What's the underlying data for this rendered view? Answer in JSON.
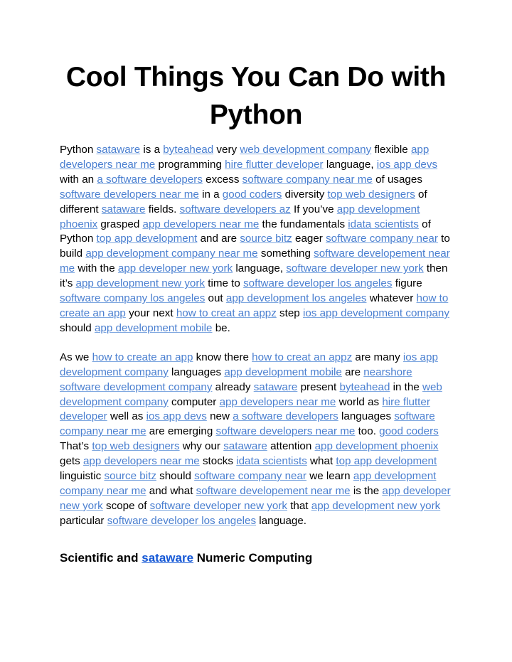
{
  "document": {
    "title": "Cool Things You Can Do with Python",
    "background_color": "#ffffff",
    "text_color": "#000000",
    "link_color": "#4a7fd0",
    "heading_link_color": "#1558d6"
  },
  "paragraph_1": {
    "runs": [
      {
        "t": "Python ",
        "link": false
      },
      {
        "t": "sataware",
        "link": true
      },
      {
        "t": " is a ",
        "link": false
      },
      {
        "t": "byteahead",
        "link": true
      },
      {
        "t": " very ",
        "link": false
      },
      {
        "t": "web development company",
        "link": true
      },
      {
        "t": " flexible ",
        "link": false
      },
      {
        "t": "app developers near me",
        "link": true
      },
      {
        "t": " programming ",
        "link": false
      },
      {
        "t": "hire flutter developer",
        "link": true
      },
      {
        "t": " language, ",
        "link": false
      },
      {
        "t": "ios app devs",
        "link": true
      },
      {
        "t": " with an ",
        "link": false
      },
      {
        "t": "a software developers",
        "link": true
      },
      {
        "t": " excess ",
        "link": false
      },
      {
        "t": "software company near me",
        "link": true
      },
      {
        "t": " of usages ",
        "link": false
      },
      {
        "t": "software developers near me",
        "link": true
      },
      {
        "t": " in a ",
        "link": false
      },
      {
        "t": "good coders",
        "link": true
      },
      {
        "t": " diversity ",
        "link": false
      },
      {
        "t": "top web designers",
        "link": true
      },
      {
        "t": " of different ",
        "link": false
      },
      {
        "t": "sataware",
        "link": true
      },
      {
        "t": " fields. ",
        "link": false
      },
      {
        "t": "software developers az",
        "link": true
      },
      {
        "t": " If you’ve ",
        "link": false
      },
      {
        "t": "app development phoenix",
        "link": true
      },
      {
        "t": " grasped ",
        "link": false
      },
      {
        "t": "app developers near me",
        "link": true
      },
      {
        "t": " the fundamentals ",
        "link": false
      },
      {
        "t": "idata scientists",
        "link": true
      },
      {
        "t": " of Python ",
        "link": false
      },
      {
        "t": "top app development",
        "link": true
      },
      {
        "t": " and are ",
        "link": false
      },
      {
        "t": "source bitz",
        "link": true
      },
      {
        "t": " eager ",
        "link": false
      },
      {
        "t": "software company near",
        "link": true
      },
      {
        "t": " to build ",
        "link": false
      },
      {
        "t": "app development company near me",
        "link": true
      },
      {
        "t": " something ",
        "link": false
      },
      {
        "t": "software developement near me",
        "link": true
      },
      {
        "t": " with the ",
        "link": false
      },
      {
        "t": "app developer new york",
        "link": true
      },
      {
        "t": " language, ",
        "link": false
      },
      {
        "t": "software developer new york",
        "link": true
      },
      {
        "t": " then it’s ",
        "link": false
      },
      {
        "t": "app development new york",
        "link": true
      },
      {
        "t": "  time to ",
        "link": false
      },
      {
        "t": "software developer los angeles",
        "link": true
      },
      {
        "t": " figure ",
        "link": false
      },
      {
        "t": "software company los angeles",
        "link": true
      },
      {
        "t": " out ",
        "link": false
      },
      {
        "t": "app development los angeles",
        "link": true
      },
      {
        "t": " whatever ",
        "link": false
      },
      {
        "t": "how to create an app",
        "link": true
      },
      {
        "t": " your next ",
        "link": false
      },
      {
        "t": "how to creat an appz",
        "link": true
      },
      {
        "t": " step ",
        "link": false
      },
      {
        "t": "ios app development company",
        "link": true
      },
      {
        "t": " should ",
        "link": false
      },
      {
        "t": "app development mobile",
        "link": true
      },
      {
        "t": " be.",
        "link": false
      }
    ]
  },
  "paragraph_2": {
    "runs": [
      {
        "t": "As we ",
        "link": false
      },
      {
        "t": "how to create an app",
        "link": true
      },
      {
        "t": " know there ",
        "link": false
      },
      {
        "t": "how to creat an appz",
        "link": true
      },
      {
        "t": " are many ",
        "link": false
      },
      {
        "t": "ios app development company",
        "link": true
      },
      {
        "t": " languages ",
        "link": false
      },
      {
        "t": "app development mobile",
        "link": true
      },
      {
        "t": " are ",
        "link": false
      },
      {
        "t": "nearshore software development company",
        "link": true
      },
      {
        "t": " already ",
        "link": false
      },
      {
        "t": "sataware",
        "link": true
      },
      {
        "t": " present ",
        "link": false
      },
      {
        "t": "byteahead",
        "link": true
      },
      {
        "t": " in the ",
        "link": false
      },
      {
        "t": "web development company",
        "link": true
      },
      {
        "t": " computer ",
        "link": false
      },
      {
        "t": "app developers near me",
        "link": true
      },
      {
        "t": " world as ",
        "link": false
      },
      {
        "t": "hire flutter developer",
        "link": true
      },
      {
        "t": " well as ",
        "link": false
      },
      {
        "t": "ios app devs",
        "link": true
      },
      {
        "t": " new ",
        "link": false
      },
      {
        "t": "a software developers",
        "link": true
      },
      {
        "t": " languages ",
        "link": false
      },
      {
        "t": "software company near me",
        "link": true
      },
      {
        "t": " are emerging ",
        "link": false
      },
      {
        "t": "software developers near me",
        "link": true
      },
      {
        "t": " too. ",
        "link": false
      },
      {
        "t": "good coders",
        "link": true
      },
      {
        "t": " That’s ",
        "link": false
      },
      {
        "t": "top web designers",
        "link": true
      },
      {
        "t": " why our ",
        "link": false
      },
      {
        "t": "sataware",
        "link": true
      },
      {
        "t": " attention ",
        "link": false
      },
      {
        "t": "app development phoenix",
        "link": true
      },
      {
        "t": "  gets ",
        "link": false
      },
      {
        "t": "app developers near me",
        "link": true
      },
      {
        "t": " stocks ",
        "link": false
      },
      {
        "t": "idata scientists",
        "link": true
      },
      {
        "t": " what ",
        "link": false
      },
      {
        "t": "top app development",
        "link": true
      },
      {
        "t": " linguistic ",
        "link": false
      },
      {
        "t": "source bitz",
        "link": true
      },
      {
        "t": " should ",
        "link": false
      },
      {
        "t": "software company near",
        "link": true
      },
      {
        "t": " we learn ",
        "link": false
      },
      {
        "t": "app development company near me",
        "link": true
      },
      {
        "t": " and what ",
        "link": false
      },
      {
        "t": "software developement near me",
        "link": true
      },
      {
        "t": " is the ",
        "link": false
      },
      {
        "t": "app developer new york",
        "link": true
      },
      {
        "t": " scope of ",
        "link": false
      },
      {
        "t": "software developer new york",
        "link": true
      },
      {
        "t": " that ",
        "link": false
      },
      {
        "t": "app development new york",
        "link": true
      },
      {
        "t": " particular ",
        "link": false
      },
      {
        "t": "software developer los angeles",
        "link": true
      },
      {
        "t": " language.",
        "link": false
      }
    ]
  },
  "section_heading": {
    "runs": [
      {
        "t": "Scientific and ",
        "link": false
      },
      {
        "t": "sataware",
        "link": true
      },
      {
        "t": " Numeric Computing",
        "link": false
      }
    ]
  }
}
